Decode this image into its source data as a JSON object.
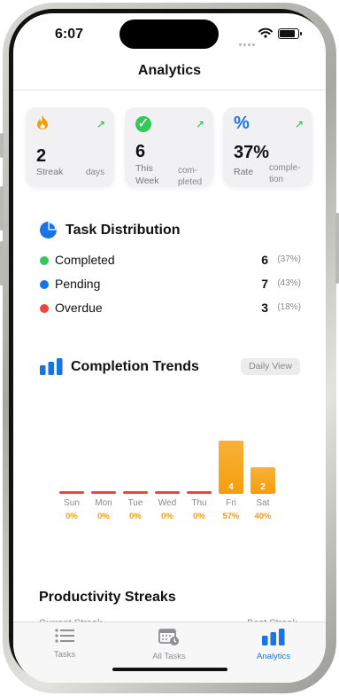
{
  "status": {
    "time": "6:07"
  },
  "nav": {
    "title": "Analytics"
  },
  "stats": [
    {
      "icon": "flame-icon",
      "value": "2",
      "label": "Streak",
      "sub": "days"
    },
    {
      "icon": "checkmark-circle-icon",
      "value": "6",
      "label_line1": "This",
      "label_line2": "Week",
      "sub_line1": "com-",
      "sub_line2": "pleted"
    },
    {
      "icon": "percent-icon",
      "value": "37%",
      "label": "Rate",
      "sub_line1": "comple-",
      "sub_line2": "tion"
    }
  ],
  "distribution": {
    "title": "Task Distribution",
    "items": [
      {
        "name": "Completed",
        "count": "6",
        "pct": "(37%)",
        "color": "#34c759"
      },
      {
        "name": "Pending",
        "count": "7",
        "pct": "(43%)",
        "color": "#1a73e8"
      },
      {
        "name": "Overdue",
        "count": "3",
        "pct": "(18%)",
        "color": "#f0433a"
      }
    ]
  },
  "trends": {
    "title": "Completion Trends",
    "view_label": "Daily View",
    "chart_data": {
      "type": "bar",
      "categories": [
        "Sun",
        "Mon",
        "Tue",
        "Wed",
        "Thu",
        "Fri",
        "Sat"
      ],
      "values": [
        0,
        0,
        0,
        0,
        0,
        4,
        2
      ],
      "percent_labels": [
        "0%",
        "0%",
        "0%",
        "0%",
        "0%",
        "57%",
        "40%"
      ],
      "bar_color": "#f59e0b",
      "zero_color": "#f0433a"
    }
  },
  "streaks": {
    "title": "Productivity Streaks",
    "left_label": "Current Streak",
    "right_label": "Best Streak"
  },
  "tabbar": {
    "items": [
      {
        "label": "Tasks",
        "icon": "list-icon",
        "active": false
      },
      {
        "label": "All Tasks",
        "icon": "calendar-clock-icon",
        "active": false
      },
      {
        "label": "Analytics",
        "icon": "bar-chart-icon",
        "active": true
      }
    ],
    "active_color": "#1a73e8",
    "inactive_color": "#8e8e93"
  }
}
